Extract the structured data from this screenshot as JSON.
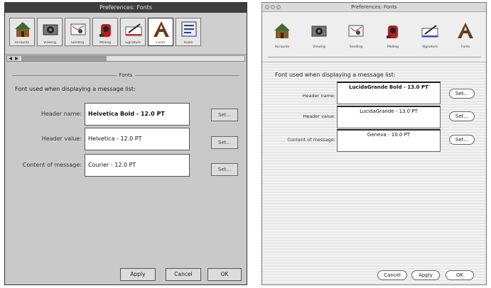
{
  "left": {
    "title": "Preferences: Fonts",
    "toolbar": [
      {
        "label": "Accounts",
        "icon": "house-icon"
      },
      {
        "label": "Viewing",
        "icon": "camera-icon"
      },
      {
        "label": "Sending",
        "icon": "sending-icon"
      },
      {
        "label": "Mailing",
        "icon": "mailbox-icon"
      },
      {
        "label": "Signature",
        "icon": "signature-icon"
      },
      {
        "label": "Fonts",
        "icon": "fonts-icon",
        "selected": true
      },
      {
        "label": "Rules",
        "icon": "rules-icon"
      }
    ],
    "section_title": "Fonts",
    "instruction": "Font used when displaying a message list:",
    "rows": [
      {
        "label": "Header name:",
        "value": "Helvetica Bold - 12.0 PT",
        "bold": true,
        "button": "Set..."
      },
      {
        "label": "Header value:",
        "value": "Helvetica - 12.0 PT",
        "bold": false,
        "button": "Set..."
      },
      {
        "label": "Content of message:",
        "value": "Courier - 12.0 PT",
        "bold": false,
        "button": "Set..."
      }
    ],
    "buttons": {
      "apply": "Apply",
      "cancel": "Cancel",
      "ok": "OK"
    }
  },
  "right": {
    "title": "Preferences: Fonts",
    "toolbar": [
      {
        "label": "Accounts",
        "icon": "house-icon"
      },
      {
        "label": "Viewing",
        "icon": "camera-icon"
      },
      {
        "label": "Sending",
        "icon": "sending-icon"
      },
      {
        "label": "Mailing",
        "icon": "mailbox-icon"
      },
      {
        "label": "Signature",
        "icon": "signature-icon"
      },
      {
        "label": "Fonts",
        "icon": "fonts-icon",
        "selected": true
      }
    ],
    "instruction": "Font used when displaying a message list:",
    "rows": [
      {
        "label": "Header name:",
        "value": "LucidaGrande Bold - 13.0 PT",
        "button": "Set..."
      },
      {
        "label": "Header value:",
        "value": "LucidaGrande - 13.0 PT",
        "button": "Set..."
      },
      {
        "label": "Content of message:",
        "value": "Geneva - 10.0 PT",
        "button": "Set..."
      }
    ],
    "buttons": {
      "cancel": "Cancel",
      "apply": "Apply",
      "ok": "OK"
    }
  },
  "colors": {
    "classic_bg": "#c9c9c9",
    "classic_title": "#3e3e3e",
    "aqua_stripe": "#e6e6e6"
  }
}
